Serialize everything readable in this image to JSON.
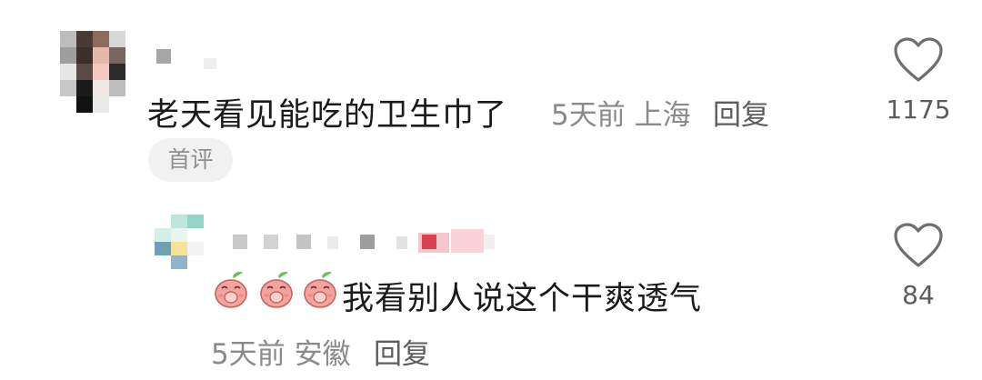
{
  "comments": [
    {
      "text": "老天看见能吃的卫生巾了",
      "time": "5天前",
      "location": "上海",
      "reply_label": "回复",
      "badge": "首评",
      "likes": "1175",
      "like_icon": "heart-outline-icon"
    }
  ],
  "replies": [
    {
      "emojis": [
        "peach-cover-mouth-emoji",
        "peach-cover-mouth-emoji",
        "peach-cover-mouth-emoji"
      ],
      "text": "我看别人说这个干爽透气",
      "time": "5天前",
      "location": "安徽",
      "reply_label": "回复",
      "likes": "84",
      "like_icon": "heart-outline-icon"
    }
  ],
  "colors": {
    "primary_text": "#1b1b1b",
    "meta_text": "#8a8a8a",
    "badge_bg": "#f1f1f1",
    "emoji_peach": "#f6a3a0",
    "emoji_leaf": "#6bbf4d"
  }
}
